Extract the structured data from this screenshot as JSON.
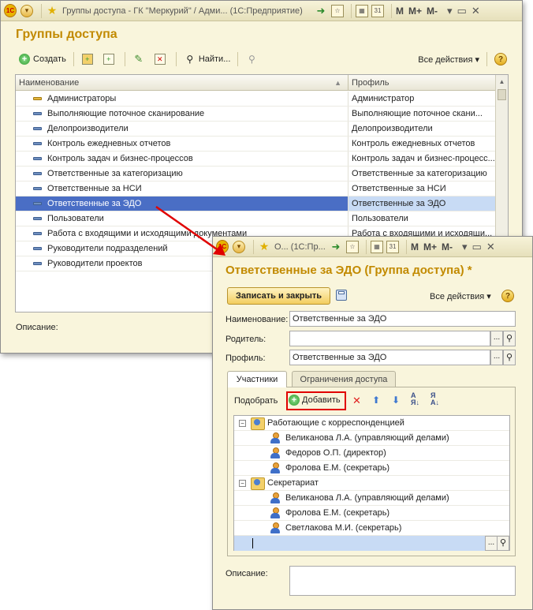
{
  "main_window": {
    "title": "Группы доступа - ГК \"Меркурий\" / Адми...   (1С:Предприятие)",
    "heading": "Группы доступа",
    "toolbar": {
      "create": "Создать",
      "find": "Найти...",
      "all_actions": "Все действия ▾"
    },
    "columns": {
      "name": "Наименование",
      "profile": "Профиль"
    },
    "rows": [
      {
        "name": "Администраторы",
        "profile": "Администратор"
      },
      {
        "name": "Выполняющие поточное сканирование",
        "profile": "Выполняющие поточное скани..."
      },
      {
        "name": "Делопроизводители",
        "profile": "Делопроизводители"
      },
      {
        "name": "Контроль ежедневных отчетов",
        "profile": "Контроль ежедневных отчетов"
      },
      {
        "name": "Контроль задач и бизнес-процессов",
        "profile": "Контроль задач и бизнес-процесс..."
      },
      {
        "name": "Ответственные за категоризацию",
        "profile": "Ответственные за категоризацию"
      },
      {
        "name": "Ответственные за НСИ",
        "profile": "Ответственные за НСИ"
      },
      {
        "name": "Ответственные за ЭДО",
        "profile": "Ответственные за ЭДО"
      },
      {
        "name": "Пользователи",
        "profile": "Пользователи"
      },
      {
        "name": "Работа с входящими и исходящими документами",
        "profile": "Работа с входящими и исходящи..."
      },
      {
        "name": "Руководители подразделений",
        "profile": ""
      },
      {
        "name": "Руководители проектов",
        "profile": ""
      }
    ],
    "description_label": "Описание:"
  },
  "child_window": {
    "title": "О...  (1С:Пр...",
    "heading": "Ответственные за ЭДО (Группа доступа) *",
    "save_close": "Записать и закрыть",
    "all_actions": "Все действия ▾",
    "name_label": "Наименование:",
    "name_value": "Ответственные за ЭДО",
    "parent_label": "Родитель:",
    "parent_value": "",
    "profile_label": "Профиль:",
    "profile_value": "Ответственные за ЭДО",
    "tabs": [
      "Участники",
      "Ограничения доступа"
    ],
    "pick": "Подобрать",
    "add": "Добавить",
    "tree": [
      {
        "type": "group",
        "label": "Работающие с корреспонденцией"
      },
      {
        "type": "user",
        "label": "Великанова Л.А. (управляющий делами)"
      },
      {
        "type": "user",
        "label": "Федоров О.П. (директор)"
      },
      {
        "type": "user",
        "label": "Фролова Е.М. (секретарь)"
      },
      {
        "type": "group",
        "label": "Секретариат"
      },
      {
        "type": "user",
        "label": "Великанова Л.А. (управляющий делами)"
      },
      {
        "type": "user",
        "label": "Фролова Е.М. (секретарь)"
      },
      {
        "type": "user",
        "label": "Светлакова М.И. (секретарь)"
      }
    ],
    "description_label": "Описание:"
  },
  "colors": {
    "title_accent": "#c28a00",
    "selection": "#4a6ec5",
    "highlight_box": "#e00000"
  }
}
